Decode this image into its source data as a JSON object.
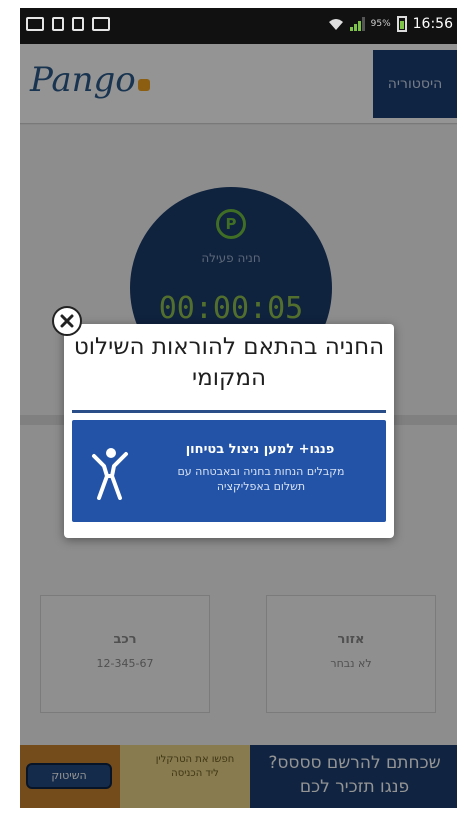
{
  "status_bar": {
    "time": "16:56",
    "battery_pct": "95%",
    "signal_level": 0.75,
    "battery_level": 0.95
  },
  "header": {
    "logo": "Pango",
    "history_button": "היסטוריה"
  },
  "timer": {
    "label": "חניה פעילה",
    "value": "00:00:05"
  },
  "cards": [
    {
      "title": "אזור",
      "subtitle": "לא נבחר"
    },
    {
      "title": "רכב",
      "subtitle": "12-345-67"
    }
  ],
  "dialog": {
    "title": "החניה בהתאם להוראות השילוט המקומי",
    "action_main": "פנגו+ למען ניצול בטיחון",
    "action_sub": "מקבלים הנחות בחניה ובאבטחה עם תשלום באפליקציה",
    "colors": {
      "accent": "#2353a7",
      "separator": "#2a4e87"
    }
  },
  "banner": {
    "pill_label": "השיטוק",
    "mid_text": "חפשו את הטרקלין ליד הכניסה",
    "main_text": "שכחתם להרשם סססס? פנגו תזכיר לכם"
  },
  "icons": {
    "close": "close-icon",
    "person": "person-icon",
    "parking": "parking-icon",
    "wifi": "wifi-icon"
  }
}
